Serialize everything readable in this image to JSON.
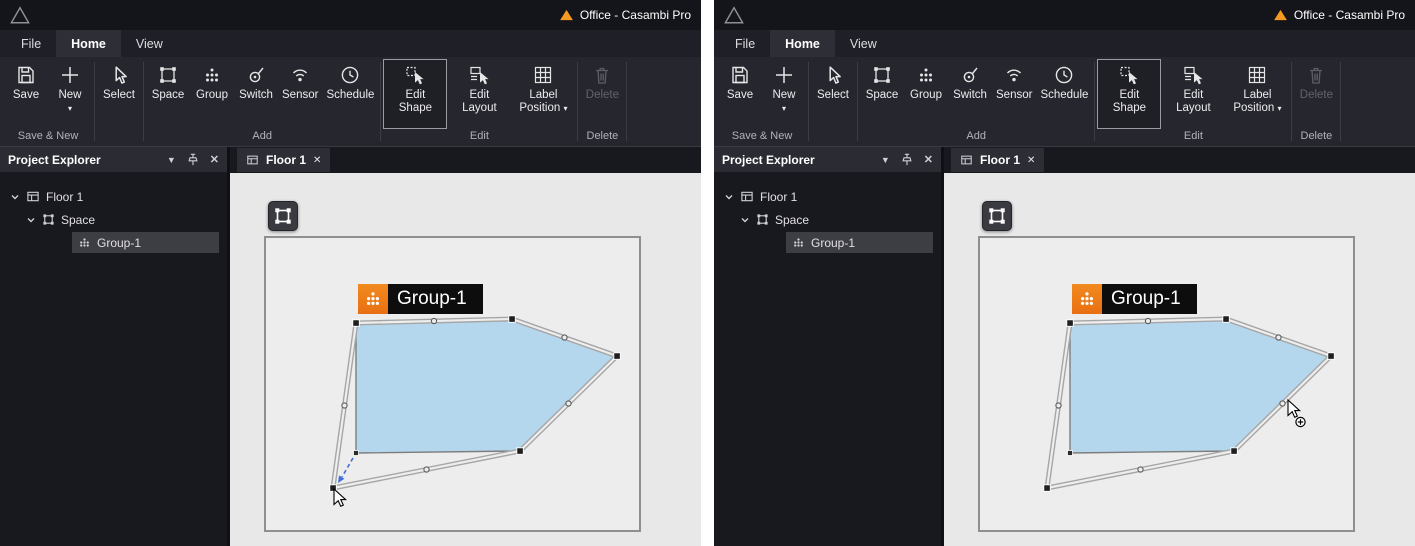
{
  "window": {
    "title": "Office - Casambi Pro"
  },
  "menu": {
    "file": "File",
    "home": "Home",
    "view": "View"
  },
  "ribbon": {
    "save": "Save",
    "new": "New",
    "select": "Select",
    "space": "Space",
    "group": "Group",
    "switch": "Switch",
    "sensor": "Sensor",
    "schedule": "Schedule",
    "edit_shape": "Edit Shape",
    "edit_layout": "Edit Layout",
    "label_position": "Label Position",
    "delete": "Delete",
    "groups": {
      "save_new": "Save & New",
      "add": "Add",
      "edit": "Edit",
      "delete": "Delete"
    }
  },
  "explorer": {
    "title": "Project Explorer",
    "floor": "Floor 1",
    "space": "Space",
    "group": "Group-1"
  },
  "tab": {
    "label": "Floor 1"
  },
  "canvas": {
    "group_label": "Group-1"
  },
  "icons": {
    "dropdown_caret": "▾",
    "header_collapse": "▼",
    "close": "✕"
  },
  "colors": {
    "accent_orange": "#ee7b1c",
    "shape_fill_blue": "#b5d7ee",
    "drag_arrow_blue": "#3f6fd8"
  }
}
